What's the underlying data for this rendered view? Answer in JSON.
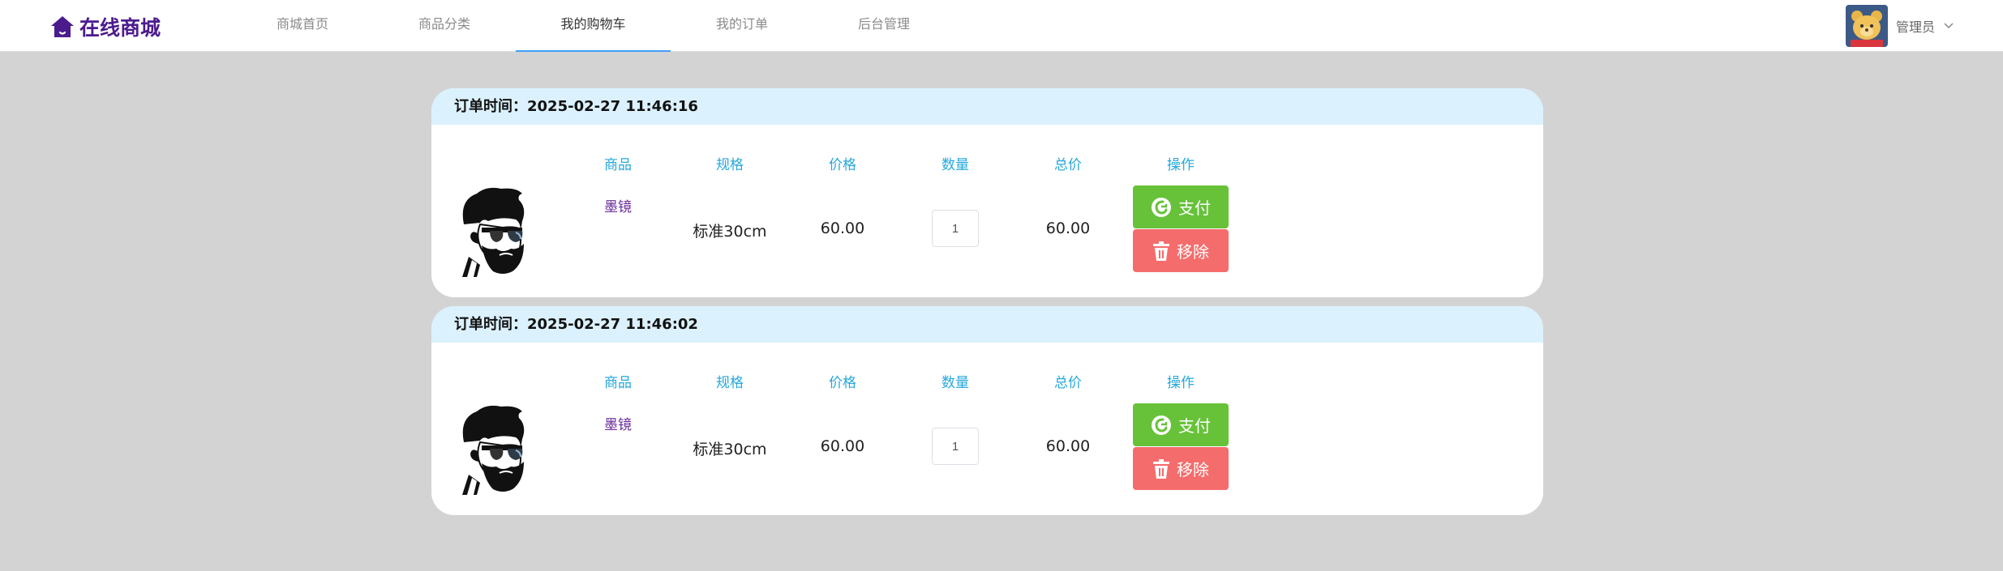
{
  "header": {
    "logo_text": "在线商城",
    "nav": [
      {
        "label": "商城首页",
        "active": false
      },
      {
        "label": "商品分类",
        "active": false
      },
      {
        "label": "我的购物车",
        "active": true
      },
      {
        "label": "我的订单",
        "active": false
      },
      {
        "label": "后台管理",
        "active": false
      }
    ],
    "user_name": "管理员"
  },
  "columns": {
    "product": "商品",
    "spec": "规格",
    "price": "价格",
    "quantity": "数量",
    "total": "总价",
    "action": "操作"
  },
  "orders": [
    {
      "time_label": "订单时间：",
      "time": "2025-02-27 11:46:16",
      "product_name": "墨镜",
      "spec": "标准30cm",
      "price": "60.00",
      "quantity": "1",
      "total": "60.00",
      "pay_label": "支付",
      "remove_label": "移除"
    },
    {
      "time_label": "订单时间：",
      "time": "2025-02-27 11:46:02",
      "product_name": "墨镜",
      "spec": "标准30cm",
      "price": "60.00",
      "quantity": "1",
      "total": "60.00",
      "pay_label": "支付",
      "remove_label": "移除"
    }
  ],
  "colors": {
    "brand": "#4b1b8e",
    "accent": "#409eff",
    "column_header": "#26a8dc",
    "pay": "#67c23a",
    "remove": "#f56c6c",
    "card_header_bg": "#dbf1fd",
    "page_bg": "#d3d3d3"
  },
  "icons": {
    "logo": "home-icon",
    "user_menu": "chevron-down-icon",
    "pay": "pay-icon",
    "remove": "trash-icon"
  }
}
